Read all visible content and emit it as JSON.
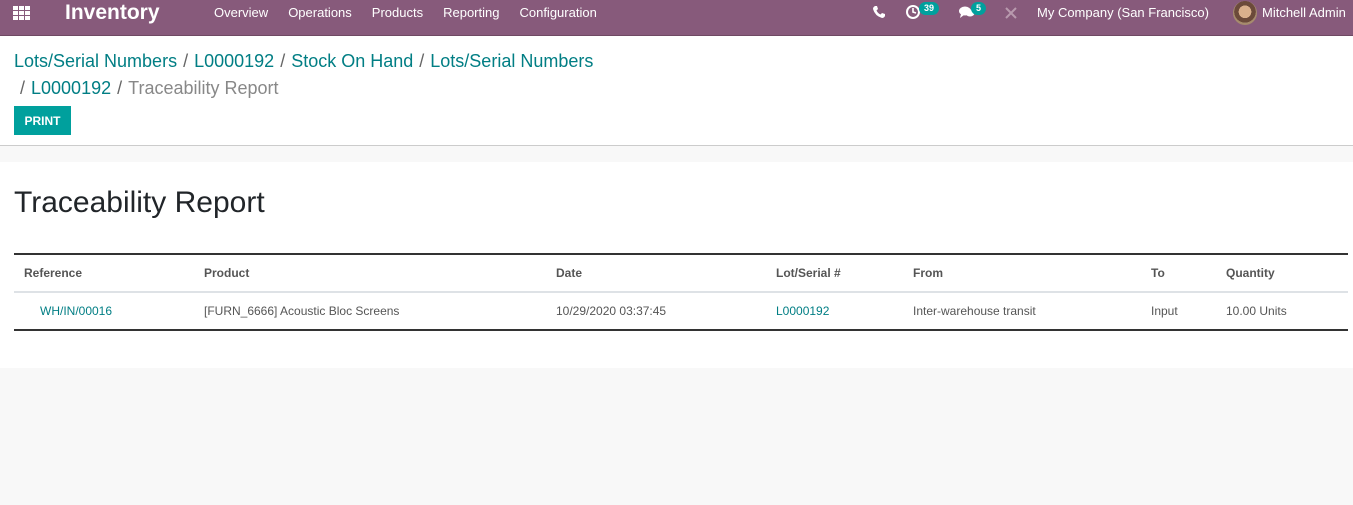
{
  "navbar": {
    "app_title": "Inventory",
    "menu": [
      "Overview",
      "Operations",
      "Products",
      "Reporting",
      "Configuration"
    ],
    "activity_count": "39",
    "message_count": "5",
    "company": "My Company (San Francisco)",
    "user": "Mitchell Admin",
    "icons": [
      "apps-grid-icon",
      "phone-icon",
      "activity-clock-icon",
      "chat-icon",
      "debug-icon"
    ]
  },
  "breadcrumb": {
    "items": [
      "Lots/Serial Numbers",
      "L0000192",
      "Stock On Hand",
      "Lots/Serial Numbers",
      "L0000192"
    ],
    "active": "Traceability Report",
    "separator": "/"
  },
  "buttons": {
    "print": "PRINT"
  },
  "report": {
    "title": "Traceability Report",
    "columns": [
      "Reference",
      "Product",
      "Date",
      "Lot/Serial #",
      "From",
      "To",
      "Quantity"
    ],
    "rows": [
      {
        "reference": "WH/IN/00016",
        "product": "[FURN_6666] Acoustic Bloc Screens",
        "date": "10/29/2020 03:37:45",
        "lot": "L0000192",
        "from": "Inter-warehouse transit",
        "to": "Input",
        "quantity": "10.00 Units"
      }
    ]
  },
  "colors": {
    "navbar": "#875a7b",
    "accent": "#00a09d",
    "link": "#017e84"
  }
}
